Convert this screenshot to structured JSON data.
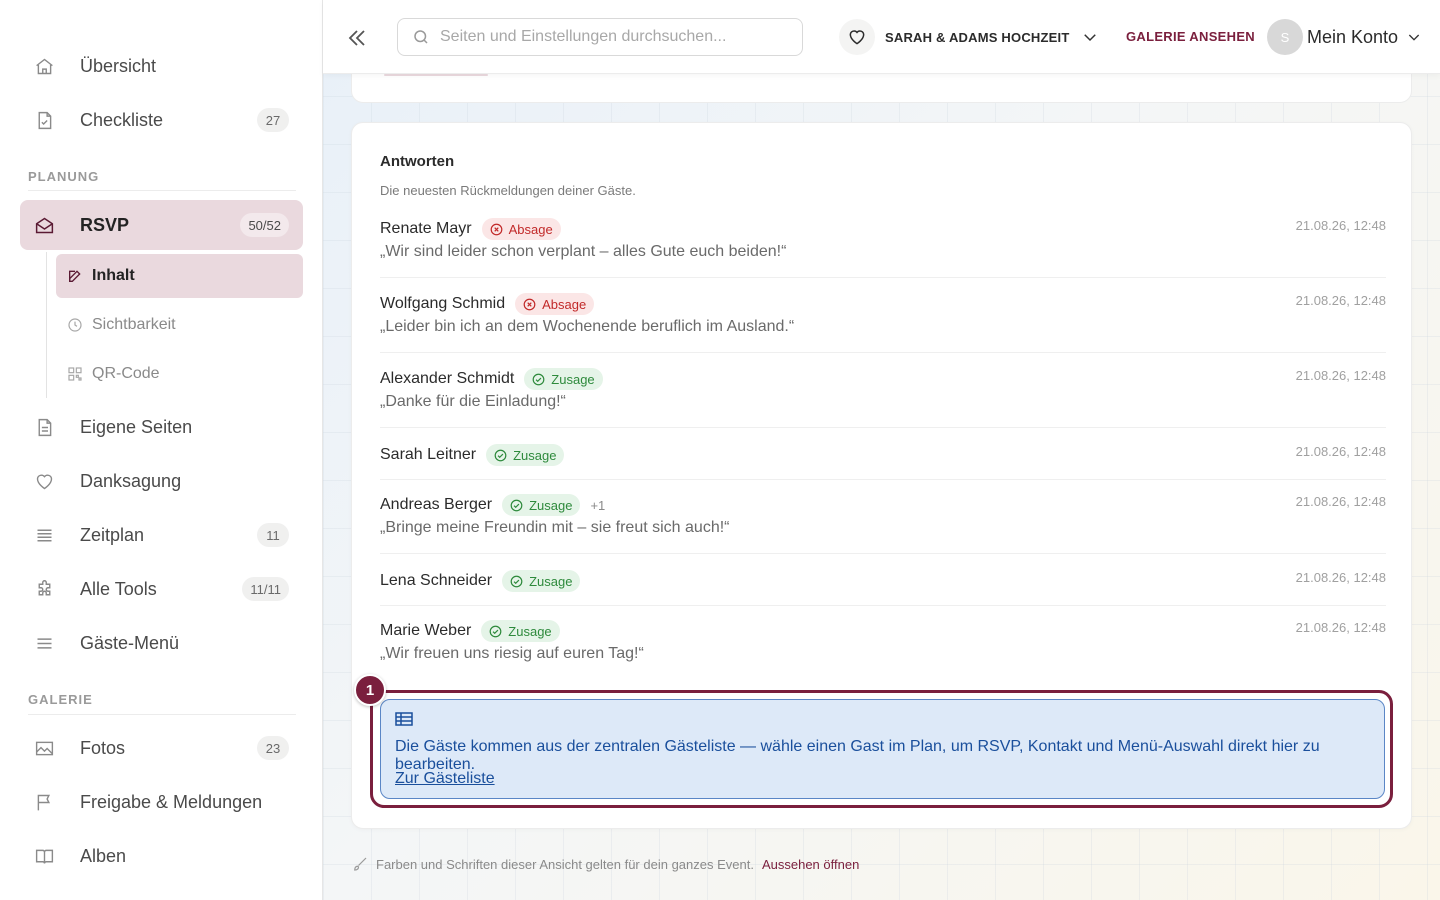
{
  "sidebar": {
    "items_top": [
      {
        "label": "Übersicht",
        "icon": "home-icon"
      },
      {
        "label": "Checkliste",
        "icon": "checklist-icon",
        "badge": "27"
      }
    ],
    "section_planung": "PLANUNG",
    "rsvp": {
      "label": "RSVP",
      "icon": "envelope-icon",
      "badge": "50/52"
    },
    "rsvp_sub": [
      {
        "label": "Inhalt",
        "icon": "edit-icon"
      },
      {
        "label": "Sichtbarkeit",
        "icon": "clock-icon"
      },
      {
        "label": "QR-Code",
        "icon": "qr-code-icon"
      }
    ],
    "items_planung": [
      {
        "label": "Eigene Seiten",
        "icon": "page-icon"
      },
      {
        "label": "Danksagung",
        "icon": "heart-icon"
      },
      {
        "label": "Zeitplan",
        "icon": "list-icon",
        "badge": "11"
      },
      {
        "label": "Alle Tools",
        "icon": "puzzle-icon",
        "badge": "11/11"
      },
      {
        "label": "Gäste-Menü",
        "icon": "menu-icon"
      }
    ],
    "section_galerie": "GALERIE",
    "items_galerie": [
      {
        "label": "Fotos",
        "icon": "image-icon",
        "badge": "23"
      },
      {
        "label": "Freigabe & Meldungen",
        "icon": "flag-icon"
      },
      {
        "label": "Alben",
        "icon": "book-icon"
      }
    ]
  },
  "topbar": {
    "search_placeholder": "Seiten und Einstellungen durchsuchen...",
    "event_name": "SARAH & ADAMS HOCHZEIT",
    "gallery_link": "GALERIE ANSEHEN",
    "avatar_initial": "S",
    "account_label": "Mein Konto"
  },
  "responses": {
    "title": "Antworten",
    "subtitle": "Die neuesten Rückmeldungen deiner Gäste.",
    "items": [
      {
        "name": "Renate Mayr",
        "status": "Absage",
        "type": "no",
        "time": "21.08.26, 12:48",
        "message": "„Wir sind leider schon verplant – alles Gute euch beiden!“"
      },
      {
        "name": "Wolfgang Schmid",
        "status": "Absage",
        "type": "no",
        "time": "21.08.26, 12:48",
        "message": "„Leider bin ich an dem Wochenende beruflich im Ausland.“"
      },
      {
        "name": "Alexander Schmidt",
        "status": "Zusage",
        "type": "yes",
        "time": "21.08.26, 12:48",
        "message": "„Danke für die Einladung!“"
      },
      {
        "name": "Sarah Leitner",
        "status": "Zusage",
        "type": "yes",
        "time": "21.08.26, 12:48",
        "message": ""
      },
      {
        "name": "Andreas Berger",
        "status": "Zusage",
        "type": "yes",
        "plus": "+1",
        "time": "21.08.26, 12:48",
        "message": "„Bringe meine Freundin mit – sie freut sich auch!“"
      },
      {
        "name": "Lena Schneider",
        "status": "Zusage",
        "type": "yes",
        "time": "21.08.26, 12:48",
        "message": ""
      },
      {
        "name": "Marie Weber",
        "status": "Zusage",
        "type": "yes",
        "time": "21.08.26, 12:48",
        "message": "„Wir freuen uns riesig auf euren Tag!“"
      }
    ]
  },
  "callout": {
    "step": "1",
    "text": "Die Gäste kommen aus der zentralen Gästeliste — wähle einen Gast im Plan, um RSVP, Kontakt und Menü-Auswahl direkt hier zu bearbeiten.",
    "link": "Zur Gästeliste"
  },
  "footer": {
    "note": "Farben und Schriften dieser Ansicht gelten für dein ganzes Event.",
    "link": "Aussehen öffnen"
  },
  "colors": {
    "accent": "#7a1f3d",
    "active_bg": "#ead9de",
    "decline": "#c22a2a",
    "accept": "#2e8a3c",
    "info_bg": "#dde9f8",
    "info_text": "#1a4f9c"
  }
}
